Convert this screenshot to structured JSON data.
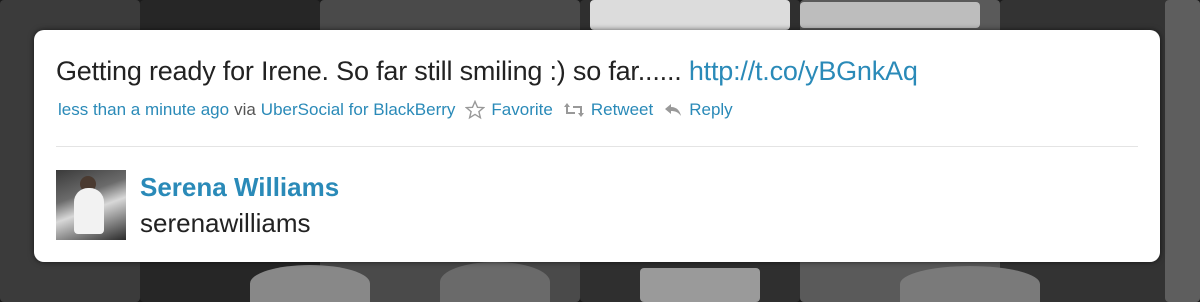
{
  "tweet": {
    "text": "Getting ready for Irene. So far still smiling :) so far......",
    "link": "http://t.co/yBGnkAq"
  },
  "meta": {
    "timestamp": "less than a minute ago",
    "via_label": "via",
    "source": "UberSocial for BlackBerry",
    "favorite_label": "Favorite",
    "retweet_label": "Retweet",
    "reply_label": "Reply"
  },
  "user": {
    "name": "Serena Williams",
    "handle": "serenawilliams"
  },
  "colors": {
    "link": "#2a8ab8",
    "text": "#222222",
    "card_bg": "#ffffff"
  },
  "icons": {
    "favorite": "star-icon",
    "retweet": "retweet-icon",
    "reply": "reply-icon"
  }
}
